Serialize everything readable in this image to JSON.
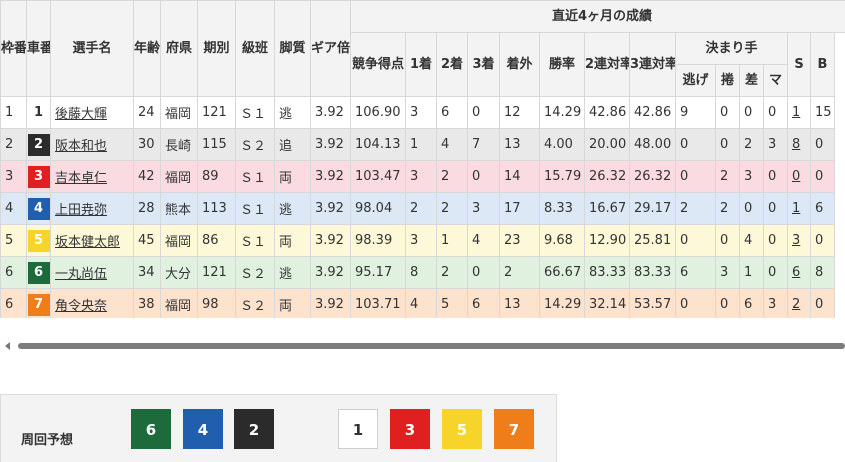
{
  "headers": {
    "waku": "枠番",
    "sha": "車番",
    "name": "選手名",
    "age": "年齢",
    "pref": "府県",
    "term": "期別",
    "class": "級班",
    "style": "脚質",
    "gear": "ギア倍率",
    "recent": "直近4ヶ月の成績",
    "score": "競争得点",
    "first": "1着",
    "second": "2着",
    "third": "3着",
    "out": "着外",
    "win_rate": "勝率",
    "top2": "2連対率",
    "top3": "3連対率",
    "kimarite": "決まり手",
    "nige": "逃げ",
    "makuri": "捲",
    "sashi": "差",
    "ma": "マ",
    "s": "S",
    "b": "B"
  },
  "racers": [
    {
      "waku": "1",
      "car": "1",
      "car_bg": "#ffffff",
      "car_fg": "#333333",
      "name": "後藤大輝",
      "age": "24",
      "pref": "福岡",
      "term": "121",
      "class": "Ｓ１",
      "style": "逃",
      "gear": "3.92",
      "score": "106.90",
      "first": "3",
      "second": "6",
      "third": "0",
      "out": "12",
      "win": "14.29",
      "top2": "42.86",
      "top3": "42.86",
      "nige": "9",
      "makuri": "0",
      "sashi": "0",
      "ma": "0",
      "s": "1",
      "b": "15"
    },
    {
      "waku": "2",
      "car": "2",
      "car_bg": "#2b2b2b",
      "car_fg": "#ffffff",
      "name": "阪本和也",
      "age": "30",
      "pref": "長崎",
      "term": "115",
      "class": "Ｓ２",
      "style": "追",
      "gear": "3.92",
      "score": "104.13",
      "first": "1",
      "second": "4",
      "third": "7",
      "out": "13",
      "win": "4.00",
      "top2": "20.00",
      "top3": "48.00",
      "nige": "0",
      "makuri": "0",
      "sashi": "2",
      "ma": "3",
      "s": "8",
      "b": "0"
    },
    {
      "waku": "3",
      "car": "3",
      "car_bg": "#e02020",
      "car_fg": "#ffffff",
      "name": "吉本卓仁",
      "age": "42",
      "pref": "福岡",
      "term": "89",
      "class": "Ｓ１",
      "style": "両",
      "gear": "3.92",
      "score": "103.47",
      "first": "3",
      "second": "2",
      "third": "0",
      "out": "14",
      "win": "15.79",
      "top2": "26.32",
      "top3": "26.32",
      "nige": "0",
      "makuri": "2",
      "sashi": "3",
      "ma": "0",
      "s": "0",
      "b": "0"
    },
    {
      "waku": "4",
      "car": "4",
      "car_bg": "#1f5fae",
      "car_fg": "#ffffff",
      "name": "上田尭弥",
      "age": "28",
      "pref": "熊本",
      "term": "113",
      "class": "Ｓ１",
      "style": "逃",
      "gear": "3.92",
      "score": "98.04",
      "first": "2",
      "second": "2",
      "third": "3",
      "out": "17",
      "win": "8.33",
      "top2": "16.67",
      "top3": "29.17",
      "nige": "2",
      "makuri": "2",
      "sashi": "0",
      "ma": "0",
      "s": "1",
      "b": "6"
    },
    {
      "waku": "5",
      "car": "5",
      "car_bg": "#f6d42a",
      "car_fg": "#ffffff",
      "name": "坂本健太郎",
      "age": "45",
      "pref": "福岡",
      "term": "86",
      "class": "Ｓ１",
      "style": "両",
      "gear": "3.92",
      "score": "98.39",
      "first": "3",
      "second": "1",
      "third": "4",
      "out": "23",
      "win": "9.68",
      "top2": "12.90",
      "top3": "25.81",
      "nige": "0",
      "makuri": "0",
      "sashi": "4",
      "ma": "0",
      "s": "3",
      "b": "0"
    },
    {
      "waku": "6",
      "car": "6",
      "car_bg": "#1d6b3a",
      "car_fg": "#ffffff",
      "name": "一丸尚伍",
      "age": "34",
      "pref": "大分",
      "term": "121",
      "class": "Ｓ２",
      "style": "逃",
      "gear": "3.92",
      "score": "95.17",
      "first": "8",
      "second": "2",
      "third": "0",
      "out": "2",
      "win": "66.67",
      "top2": "83.33",
      "top3": "83.33",
      "nige": "6",
      "makuri": "3",
      "sashi": "1",
      "ma": "0",
      "s": "6",
      "b": "8"
    },
    {
      "waku": "6",
      "car": "7",
      "car_bg": "#ee7d1a",
      "car_fg": "#ffffff",
      "name": "角令央奈",
      "age": "38",
      "pref": "福岡",
      "term": "98",
      "class": "Ｓ２",
      "style": "両",
      "gear": "3.92",
      "score": "103.71",
      "first": "4",
      "second": "5",
      "third": "6",
      "out": "13",
      "win": "14.29",
      "top2": "32.14",
      "top3": "53.57",
      "nige": "0",
      "makuri": "0",
      "sashi": "6",
      "ma": "3",
      "s": "2",
      "b": "0"
    }
  ],
  "prediction": {
    "label": "周回予想",
    "boxes": [
      {
        "num": "6",
        "bg": "#1d6b3a",
        "fg": "#ffffff",
        "border": "#1d6b3a"
      },
      {
        "num": "4",
        "bg": "#1f5fae",
        "fg": "#ffffff",
        "border": "#1f5fae"
      },
      {
        "num": "2",
        "bg": "#2b2b2b",
        "fg": "#ffffff",
        "border": "#2b2b2b"
      },
      {
        "num": "1",
        "bg": "#ffffff",
        "fg": "#333333",
        "border": "#cfcfcf"
      },
      {
        "num": "3",
        "bg": "#e02020",
        "fg": "#ffffff",
        "border": "#e02020"
      },
      {
        "num": "5",
        "bg": "#f6d42a",
        "fg": "#ffffff",
        "border": "#f6d42a"
      },
      {
        "num": "7",
        "bg": "#ee7d1a",
        "fg": "#ffffff",
        "border": "#ee7d1a"
      }
    ]
  }
}
